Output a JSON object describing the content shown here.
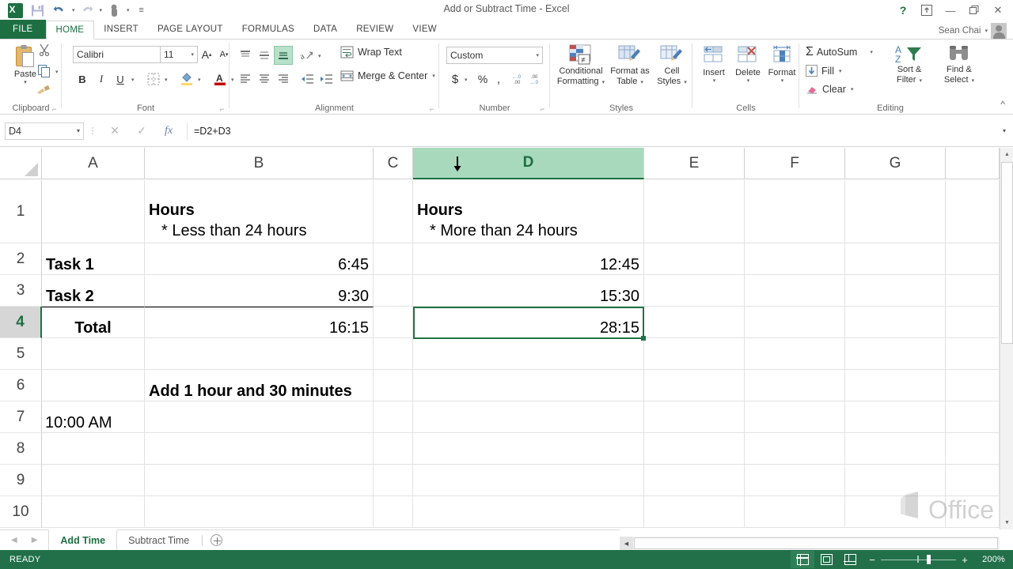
{
  "window": {
    "title": "Add or Subtract Time - Excel",
    "account_name": "Sean Chai",
    "help_icon": "?",
    "ribbon_display_icon": "ribbon-display-options-icon",
    "minimize_icon": "minimize-icon",
    "restore_icon": "restore-icon",
    "close_icon": "close-icon"
  },
  "quick_access": {
    "app_icon": "excel-logo-icon",
    "save_icon": "save-icon",
    "undo_icon": "undo-icon",
    "redo_icon": "redo-icon",
    "touch_mode_icon": "touch-mouse-mode-icon",
    "customize_icon": "customize-qat-icon"
  },
  "ribbon": {
    "tabs": [
      {
        "label": "FILE",
        "active": false
      },
      {
        "label": "HOME",
        "active": true
      },
      {
        "label": "INSERT",
        "active": false
      },
      {
        "label": "PAGE LAYOUT",
        "active": false
      },
      {
        "label": "FORMULAS",
        "active": false
      },
      {
        "label": "DATA",
        "active": false
      },
      {
        "label": "REVIEW",
        "active": false
      },
      {
        "label": "VIEW",
        "active": false
      }
    ],
    "groups": {
      "clipboard": {
        "label": "Clipboard",
        "paste_label": "Paste",
        "cut_label": "Cut",
        "copy_label": "Copy",
        "format_painter_label": "Format Painter"
      },
      "font": {
        "label": "Font",
        "font_name": "Calibri",
        "font_size": "11",
        "grow_font": "A",
        "shrink_font": "A",
        "bold": "B",
        "italic": "I",
        "underline": "U",
        "borders_label": "Borders",
        "fill_color_label": "Fill Color",
        "font_color_label": "Font Color"
      },
      "alignment": {
        "label": "Alignment",
        "wrap_text": "Wrap Text",
        "merge_center": "Merge & Center"
      },
      "number": {
        "label": "Number",
        "format": "Custom",
        "currency": "$",
        "percent": "%",
        "comma": ",",
        "increase_decimal": "Increase Decimal",
        "decrease_decimal": "Decrease Decimal"
      },
      "styles": {
        "label": "Styles",
        "conditional_formatting": "Conditional\nFormatting",
        "conditional_formatting_l1": "Conditional",
        "conditional_formatting_l2": "Formatting",
        "format_as_table_l1": "Format as",
        "format_as_table_l2": "Table",
        "cell_styles_l1": "Cell",
        "cell_styles_l2": "Styles"
      },
      "cells": {
        "label": "Cells",
        "insert": "Insert",
        "delete": "Delete",
        "format": "Format"
      },
      "editing": {
        "label": "Editing",
        "autosum": "AutoSum",
        "fill": "Fill",
        "clear": "Clear",
        "sort_filter_l1": "Sort &",
        "sort_filter_l2": "Filter",
        "find_select_l1": "Find &",
        "find_select_l2": "Select"
      }
    },
    "collapse_icon": "collapse-ribbon-icon"
  },
  "formula_bar": {
    "name_box": "D4",
    "cancel_icon": "cancel-icon",
    "enter_icon": "confirm-icon",
    "function_icon": "fx",
    "formula": "=D2+D3",
    "expand_icon": "expand-formula-bar-icon"
  },
  "grid": {
    "columns": [
      "A",
      "B",
      "C",
      "D",
      "E",
      "F",
      "G"
    ],
    "selected_column": "D",
    "rows": [
      "1",
      "2",
      "3",
      "4",
      "5",
      "6",
      "7",
      "8",
      "9",
      "10"
    ],
    "selected_row": "4",
    "selected_cell": "D4",
    "cells": {
      "B1_line1": "Hours",
      "B1_line2": "* Less than 24 hours",
      "D1_line1": "Hours",
      "D1_line2": "* More than 24 hours",
      "A2": "Task 1",
      "B2": "6:45",
      "D2": "12:45",
      "A3": "Task 2",
      "B3": "9:30",
      "D3": "15:30",
      "A4": "Total",
      "B4": "16:15",
      "D4": "28:15",
      "B6": "Add 1 hour and 30 minutes",
      "A7": "10:00 AM"
    },
    "watermark": "Office",
    "cursor_icon": "column-select-down-arrow-cursor"
  },
  "sheet_tabs": {
    "first_icon": "previous-sheet-icon",
    "prev_icon": "next-sheet-icon",
    "tabs": [
      {
        "label": "Add Time",
        "active": true
      },
      {
        "label": "Subtract Time",
        "active": false
      }
    ],
    "new_sheet_icon": "new-sheet-icon"
  },
  "status_bar": {
    "status": "READY",
    "views": [
      {
        "name": "normal-view",
        "selected": true
      },
      {
        "name": "page-layout-view",
        "selected": false
      },
      {
        "name": "page-break-preview",
        "selected": false
      }
    ],
    "zoom_out": "−",
    "zoom_in": "+",
    "zoom_level": "200%"
  },
  "colors": {
    "excel_green": "#217346",
    "ribbon_green": "#1d6f42",
    "status_green": "#21704a",
    "selection_green": "#a8d9bd"
  }
}
